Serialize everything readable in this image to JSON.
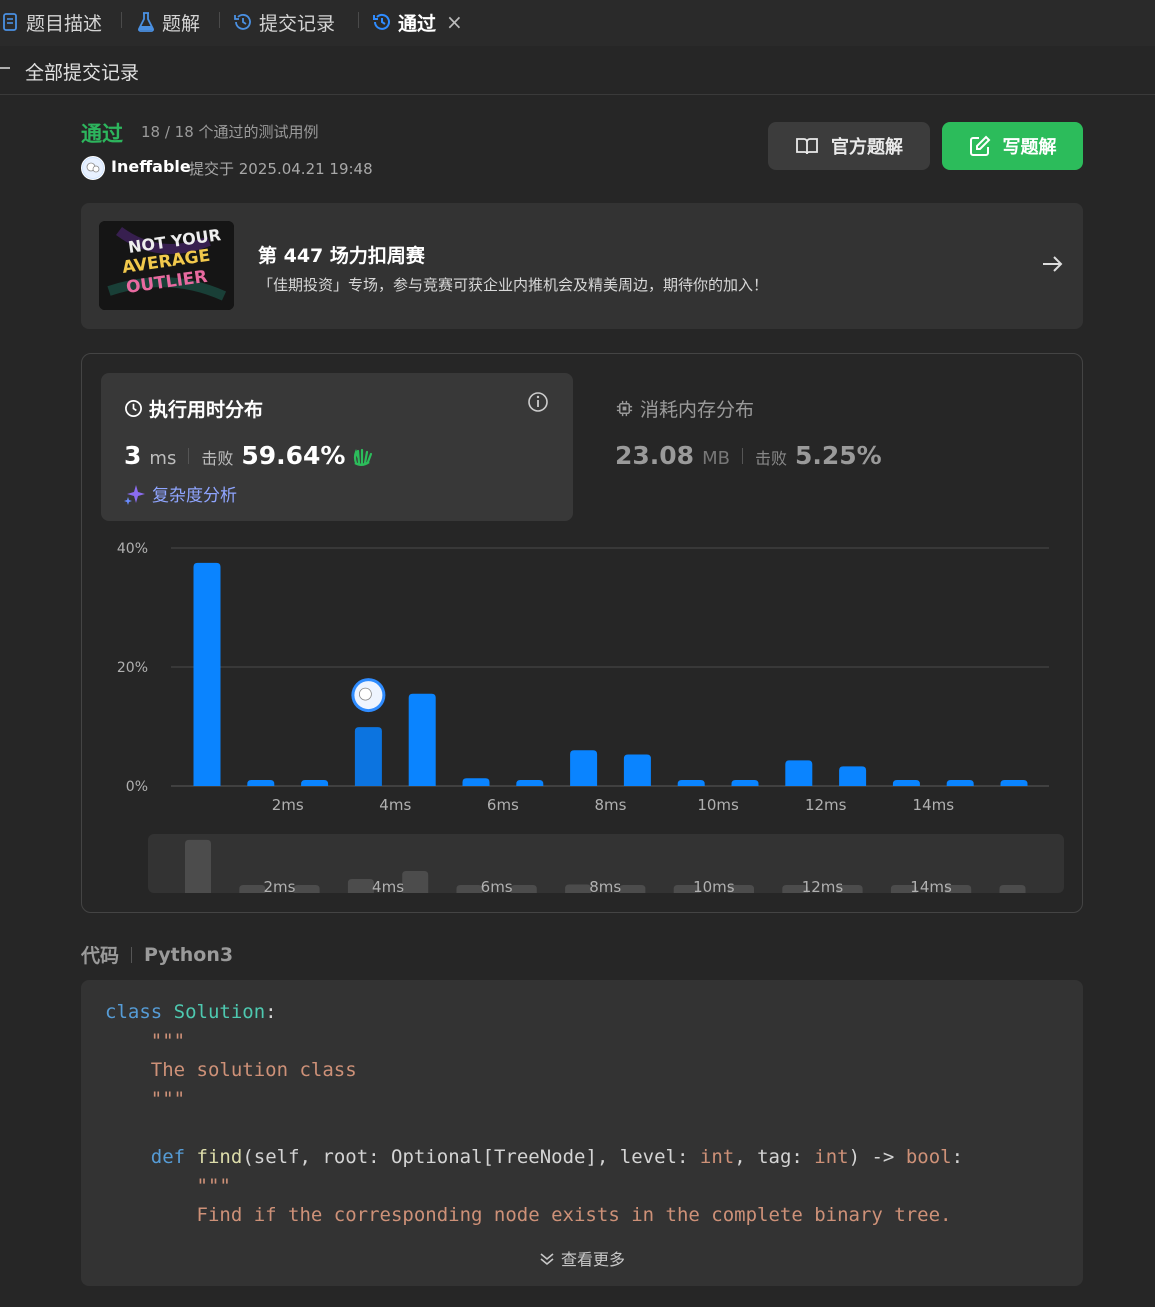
{
  "tabs": [
    {
      "label": "题目描述"
    },
    {
      "label": "题解"
    },
    {
      "label": "提交记录"
    },
    {
      "label": "通过"
    }
  ],
  "subheader": {
    "back_icon": "arrow-left-icon",
    "title": "全部提交记录"
  },
  "submission": {
    "status": "通过",
    "cases": "18 / 18 个通过的测试用例",
    "user": "Ineffable",
    "submitted_at": "提交于 2025.04.21 19:48"
  },
  "buttons": {
    "official": "官方题解",
    "write": "写题解"
  },
  "banner": {
    "title": "第 447 场力扣周赛",
    "desc": "「佳期投资」专场，参与竞赛可获企业内推机会及精美周边，期待你的加入！",
    "image_text": "NOT YOUR AVERAGE OUTLIER"
  },
  "runtime": {
    "title": "执行用时分布",
    "value": "3",
    "unit": "ms",
    "beat_label": "击败",
    "percent": "59.64%",
    "complexity": "复杂度分析"
  },
  "memory": {
    "title": "消耗内存分布",
    "value": "23.08",
    "unit": "MB",
    "beat_label": "击败",
    "percent": "5.25%"
  },
  "chart_data": {
    "type": "bar",
    "title": "",
    "xlabel": "",
    "ylabel": "",
    "ylim": [
      0,
      40
    ],
    "yticks": [
      "0%",
      "20%",
      "40%"
    ],
    "xticks": [
      "2ms",
      "4ms",
      "6ms",
      "8ms",
      "10ms",
      "12ms",
      "14ms"
    ],
    "categories": [
      "0ms",
      "1ms",
      "2ms",
      "3ms",
      "4ms",
      "5ms",
      "6ms",
      "7ms",
      "8ms",
      "9ms",
      "10ms",
      "11ms",
      "12ms",
      "13ms",
      "14ms",
      "15ms"
    ],
    "values": [
      37.5,
      0.9,
      0.9,
      9.9,
      15.5,
      1.3,
      0.9,
      6.0,
      5.3,
      0.9,
      0.9,
      4.3,
      3.3,
      0.9,
      0.9,
      0.9
    ],
    "highlight_index": 3,
    "bar_color": "#0a84ff",
    "highlight_color": "#0c74e0",
    "grid": true
  },
  "code": {
    "label": "代码",
    "language": "Python3",
    "more": "查看更多",
    "lines": [
      "class Solution:",
      "    \"\"\"",
      "    The solution class",
      "    \"\"\"",
      "",
      "    def find(self, root: Optional[TreeNode], level: int, tag: int) -> bool:",
      "        \"\"\"",
      "        Find if the corresponding node exists in the complete binary tree."
    ]
  },
  "colors": {
    "accent_green": "#2cbc5b",
    "accent_blue": "#0a84ff",
    "link_purple": "#8fa5ff"
  }
}
